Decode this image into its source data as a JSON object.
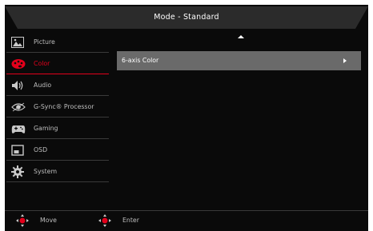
{
  "header": {
    "title": "Mode - Standard"
  },
  "sidebar": {
    "items": [
      {
        "label": "Picture",
        "icon": "picture-icon",
        "active": false
      },
      {
        "label": "Color",
        "icon": "color-palette-icon",
        "active": true
      },
      {
        "label": "Audio",
        "icon": "speaker-icon",
        "active": false
      },
      {
        "label": "G-Sync® Processor",
        "icon": "g-sync-eye-icon",
        "active": false
      },
      {
        "label": "Gaming",
        "icon": "gamepad-icon",
        "active": false
      },
      {
        "label": "OSD",
        "icon": "osd-screen-icon",
        "active": false
      },
      {
        "label": "System",
        "icon": "gear-icon",
        "active": false
      }
    ]
  },
  "main": {
    "scroll_up_icon": "up-arrow-icon",
    "rows": [
      {
        "label": "6-axis Color",
        "icon": "chevron-right-icon",
        "highlighted": true
      }
    ]
  },
  "footer": {
    "hints": [
      {
        "label": "Move",
        "icon": "joystick-move-icon"
      },
      {
        "label": "Enter",
        "icon": "joystick-enter-icon"
      }
    ]
  },
  "colors": {
    "background": "#0a0a0a",
    "accent": "#e3001b",
    "header_bar": "#2b2b2b",
    "highlight_row": "#6a6a6a",
    "text": "#bfbfbf",
    "divider": "#3a3a3a"
  }
}
